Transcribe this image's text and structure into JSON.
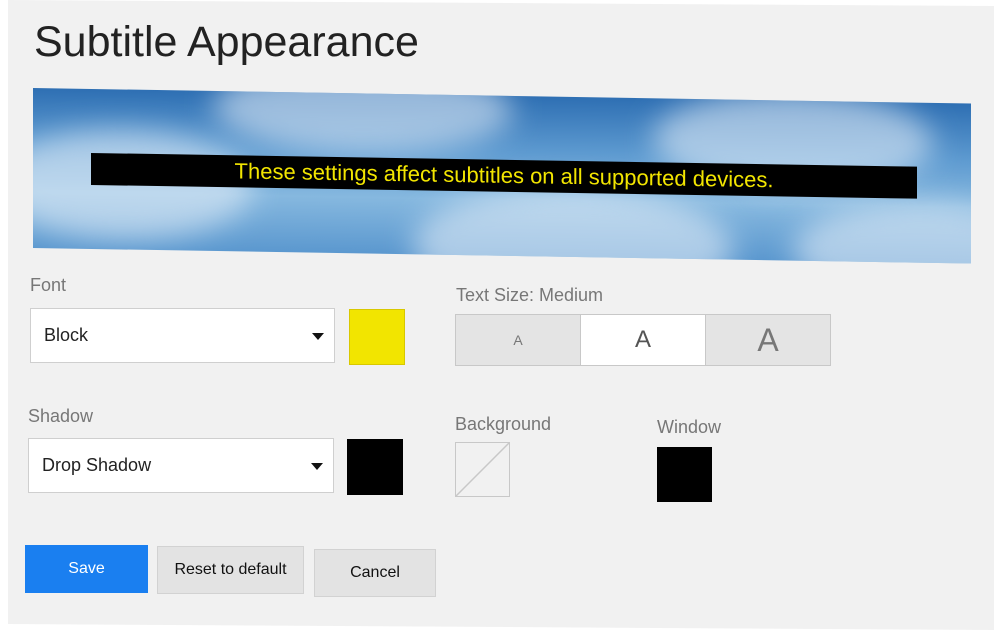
{
  "page": {
    "title": "Subtitle Appearance"
  },
  "preview": {
    "subtitle_text": "These settings affect subtitles on all supported devices.",
    "text_color": "#f2e500",
    "bar_color": "#000000"
  },
  "font": {
    "label": "Font",
    "selected": "Block",
    "color": "#f2e500"
  },
  "text_size": {
    "label": "Text Size: Medium",
    "options": [
      {
        "label": "A",
        "size": "small"
      },
      {
        "label": "A",
        "size": "medium"
      },
      {
        "label": "A",
        "size": "large"
      }
    ],
    "selected": "medium"
  },
  "shadow": {
    "label": "Shadow",
    "selected": "Drop Shadow",
    "color": "#000000"
  },
  "background": {
    "label": "Background",
    "color": "none"
  },
  "window": {
    "label": "Window",
    "color": "#000000"
  },
  "actions": {
    "save": "Save",
    "reset": "Reset to default",
    "cancel": "Cancel"
  },
  "icons": [
    "chevron-down-icon",
    "no-color-icon"
  ]
}
